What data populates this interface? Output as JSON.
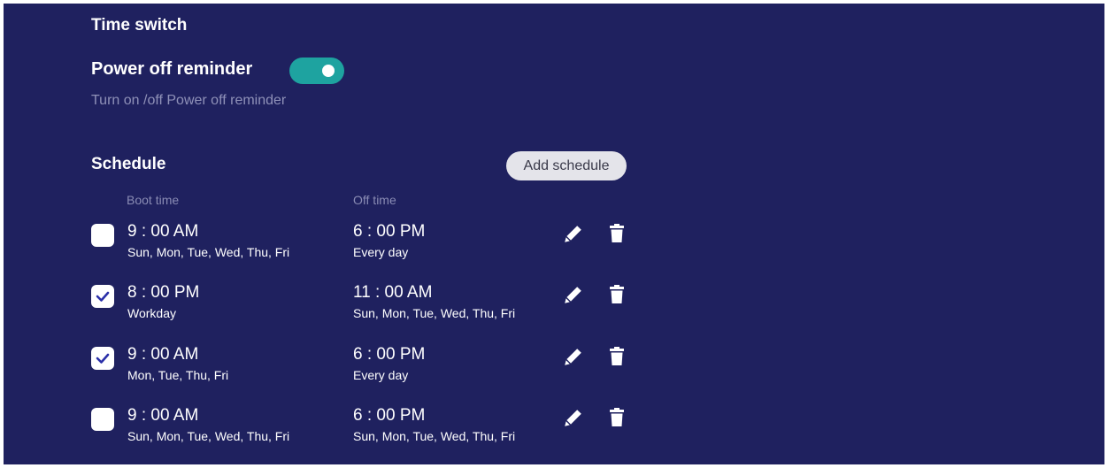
{
  "time_switch": {
    "title": "Time switch"
  },
  "power_off_reminder": {
    "label": "Power off reminder",
    "enabled": true,
    "description": "Turn on /off Power off reminder"
  },
  "schedule": {
    "title": "Schedule",
    "add_button_label": "Add schedule",
    "columns": {
      "boot": "Boot time",
      "off": "Off time"
    },
    "rows": [
      {
        "checked": false,
        "boot_time": "9 : 00 AM",
        "boot_days": "Sun, Mon, Tue, Wed, Thu, Fri",
        "off_time": "6 : 00 PM",
        "off_days": "Every day"
      },
      {
        "checked": true,
        "boot_time": "8 : 00 PM",
        "boot_days": "Workday",
        "off_time": "11 : 00 AM",
        "off_days": "Sun, Mon, Tue, Wed, Thu, Fri"
      },
      {
        "checked": true,
        "boot_time": "9 : 00 AM",
        "boot_days": "Mon, Tue, Thu, Fri",
        "off_time": "6 : 00 PM",
        "off_days": "Every day"
      },
      {
        "checked": false,
        "boot_time": "9 : 00 AM",
        "boot_days": "Sun, Mon, Tue, Wed, Thu, Fri",
        "off_time": "6 : 00 PM",
        "off_days": "Sun, Mon, Tue, Wed, Thu, Fri"
      }
    ]
  },
  "icons": {
    "edit": "pencil-icon",
    "delete": "trash-icon",
    "check": "checkmark-icon"
  },
  "colors": {
    "background": "#1f215f",
    "toggle_on": "#1ea3a0",
    "check_mark": "#2a2fa8",
    "muted_text": "#8f91b8"
  }
}
